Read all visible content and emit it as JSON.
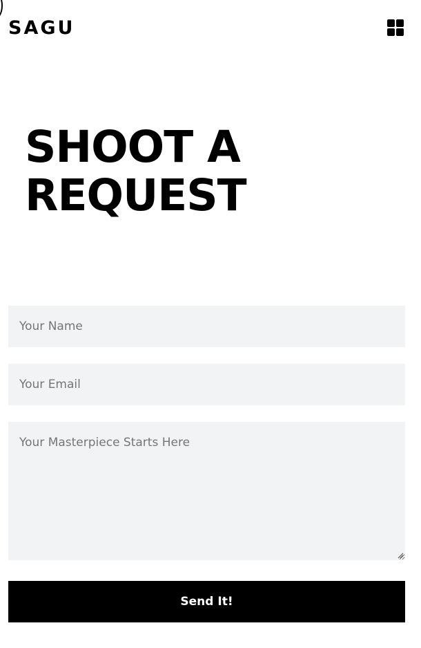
{
  "header": {
    "logo_text": "SAGU",
    "menu_icon": "grid-menu-icon"
  },
  "hero": {
    "title_line1": "SHOOT A",
    "title_line2": "REQUEST"
  },
  "form": {
    "name_placeholder": "Your Name",
    "email_placeholder": "Your Email",
    "message_placeholder": "Your Masterpiece Starts Here",
    "submit_label": "Send It!"
  },
  "colors": {
    "background": "#ffffff",
    "field_background": "#f2f3f5",
    "button_background": "#000000",
    "button_text": "#ffffff"
  }
}
